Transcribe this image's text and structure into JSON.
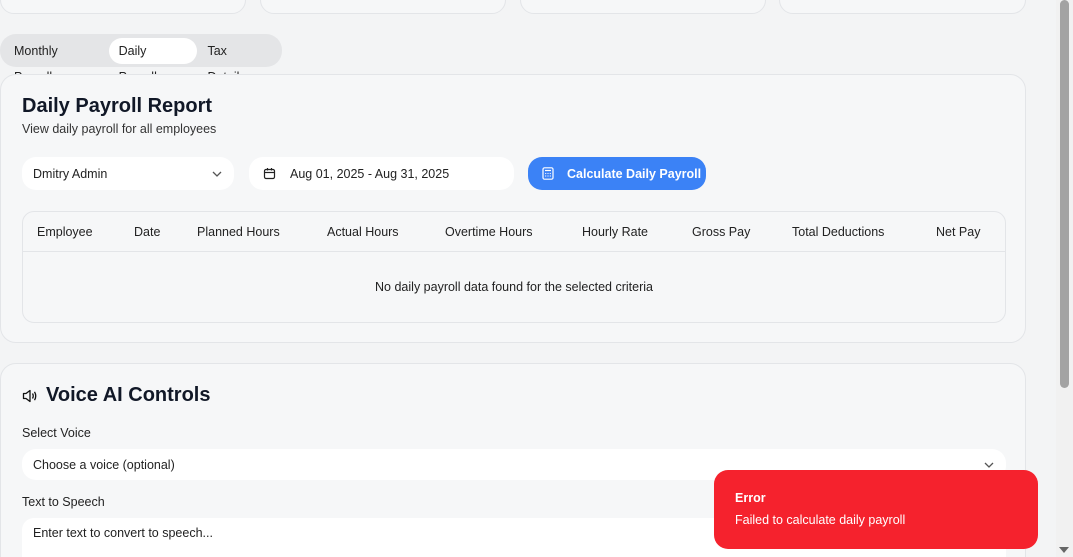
{
  "tabs": [
    "Monthly Payroll",
    "Daily Payroll",
    "Tax Details"
  ],
  "daily_report": {
    "title": "Daily Payroll Report",
    "subtitle": "View daily payroll for all employees",
    "employee_select": "Dmitry Admin",
    "date_range": "Aug 01, 2025 - Aug 31, 2025",
    "calc_button": "Calculate Daily Payroll",
    "columns": [
      "Employee",
      "Date",
      "Planned Hours",
      "Actual Hours",
      "Overtime Hours",
      "Hourly Rate",
      "Gross Pay",
      "Total Deductions",
      "Net Pay"
    ],
    "empty_message": "No daily payroll data found for the selected criteria"
  },
  "voice": {
    "title": "Voice AI Controls",
    "select_label": "Select Voice",
    "select_placeholder": "Choose a voice (optional)",
    "tts_label": "Text to Speech",
    "tts_placeholder": "Enter text to convert to speech..."
  },
  "toast": {
    "title": "Error",
    "message": "Failed to calculate daily payroll"
  },
  "colors": {
    "accent": "#3b82f6",
    "error": "#f5222d"
  }
}
